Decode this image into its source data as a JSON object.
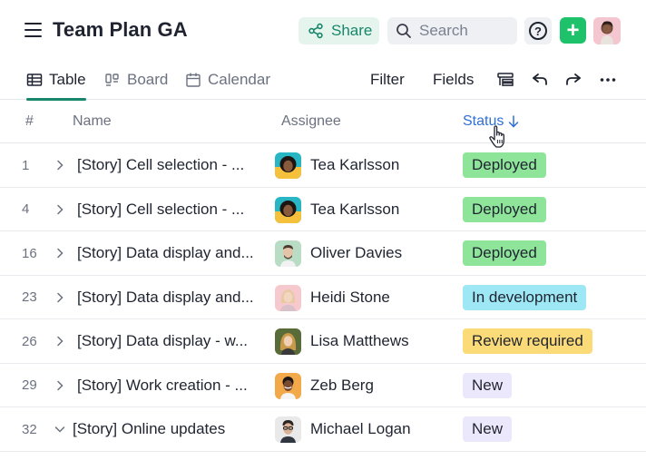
{
  "header": {
    "title": "Team Plan GA",
    "share_label": "Share",
    "search_placeholder": "Search",
    "help_label": "?",
    "add_label": "+"
  },
  "toolbar": {
    "tabs": [
      {
        "label": "Table",
        "icon": "table-icon",
        "active": true
      },
      {
        "label": "Board",
        "icon": "board-icon",
        "active": false
      },
      {
        "label": "Calendar",
        "icon": "calendar-icon",
        "active": false
      }
    ],
    "filter_label": "Filter",
    "fields_label": "Fields",
    "icons": [
      "group-icon",
      "undo-icon",
      "redo-icon",
      "more-icon"
    ]
  },
  "table": {
    "columns": {
      "num": "#",
      "name": "Name",
      "assignee": "Assignee",
      "status": "Status"
    },
    "rows": [
      {
        "num": "1",
        "name": "[Story] Cell selection - ...",
        "assignee": "Tea Karlsson",
        "status": "Deployed"
      },
      {
        "num": "4",
        "name": "[Story] Cell selection - ...",
        "assignee": "Tea Karlsson",
        "status": "Deployed"
      },
      {
        "num": "16",
        "name": "[Story] Data display and...",
        "assignee": "Oliver Davies",
        "status": "Deployed"
      },
      {
        "num": "23",
        "name": "[Story] Data display and...",
        "assignee": "Heidi Stone",
        "status": "In development"
      },
      {
        "num": "26",
        "name": "[Story] Data display - w...",
        "assignee": "Lisa Matthews",
        "status": "Review required"
      },
      {
        "num": "29",
        "name": "[Story] Work creation - ...",
        "assignee": "Zeb Berg",
        "status": "New"
      },
      {
        "num": "32",
        "name": "[Story] Online updates",
        "assignee": "Michael Logan",
        "status": "New"
      }
    ]
  },
  "colors": {
    "accent": "#17866a",
    "add_button": "#1ec26a",
    "status_deployed": "#8ee59a",
    "status_in_development": "#9ee8f5",
    "status_review_required": "#fbdb78",
    "status_new": "#ece8fb",
    "sort_active": "#2f6fd8"
  }
}
